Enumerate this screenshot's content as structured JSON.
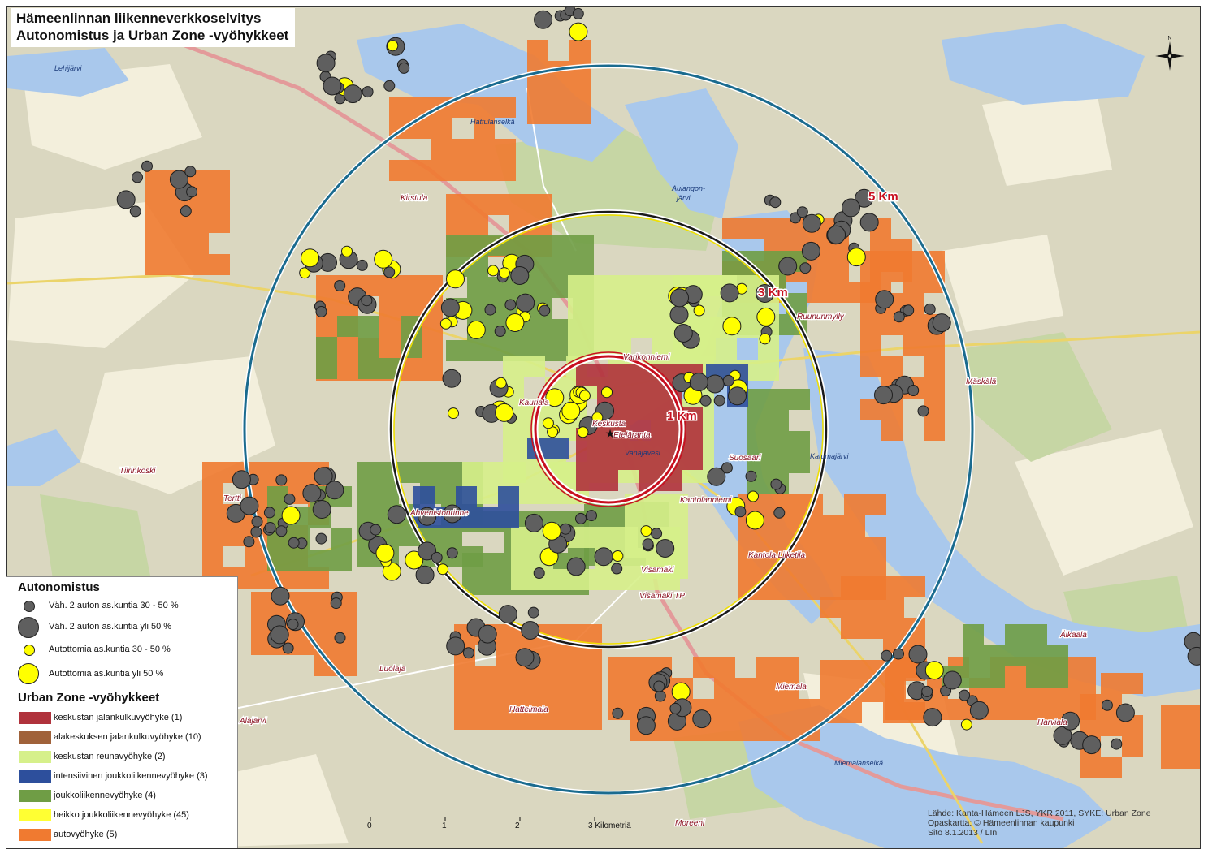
{
  "title": {
    "line1": "Hämeenlinnan liikenneverkkoselvitys",
    "line2": "Autonomistus  ja Urban Zone -vyöhykkeet"
  },
  "rings": [
    {
      "label": "1 Km",
      "color": "#c80f1f"
    },
    {
      "label": "3 Km",
      "color": "#1a1a1a"
    },
    {
      "label": "5 Km",
      "color": "#1a6b8f"
    }
  ],
  "places": [
    "Kirstula",
    "Ruununmylly",
    "Varikonniemi",
    "Kauriala",
    "Keskusta",
    "Eteläranta",
    "Suosaari",
    "Kantolanniemi",
    "Ahvenistonrinne",
    "Tertti",
    "Tiirinkoski",
    "Kantola Liiketila",
    "Visamäki",
    "Visamäki TP",
    "Luolaja",
    "Hattelmala",
    "Miemala",
    "Harviala",
    "Mäskälä",
    "Äikäälä",
    "Alajärvi",
    "Moreeni"
  ],
  "water_labels": [
    "Lehijärvi",
    "Hattulanselkä",
    "Aulangon-\njärvi",
    "Vanajavesi",
    "Katumajärvi",
    "Miemalanselkä"
  ],
  "legend": {
    "section1_title": "Autonomistus",
    "symbols": [
      {
        "label": "Väh. 2 auton as.kuntia 30 - 50 %",
        "color": "#5f5f5f",
        "size": "small"
      },
      {
        "label": "Väh. 2 auton as.kuntia yli 50 %",
        "color": "#5f5f5f",
        "size": "large"
      },
      {
        "label": "Autottomia as.kuntia 30 - 50 %",
        "color": "#ffff00",
        "size": "small"
      },
      {
        "label": "Autottomia as.kuntia yli 50 %",
        "color": "#ffff00",
        "size": "large"
      }
    ],
    "section2_title": "Urban Zone -vyöhykkeet",
    "zones": [
      {
        "label": "keskustan jalankulkuvyöhyke (1)",
        "color": "#b0323c"
      },
      {
        "label": "alakeskuksen jalankulkuvyöhyke (10)",
        "color": "#a0623a"
      },
      {
        "label": "keskustan reunavyöhyke (2)",
        "color": "#d6f08a"
      },
      {
        "label": "intensiivinen joukkoliikennevyöhyke (3)",
        "color": "#2d4f9c"
      },
      {
        "label": "joukkoliikennevyöhyke (4)",
        "color": "#6f9d45"
      },
      {
        "label": "heikko joukkoliikennevyöhyke (45)",
        "color": "#ffff33"
      },
      {
        "label": "autovyöhyke (5)",
        "color": "#f07a30"
      }
    ]
  },
  "scale": {
    "labels": [
      "0",
      "1",
      "2",
      "3 Kilometriä"
    ]
  },
  "credits": {
    "line1": "Lähde: Kanta-Hämeen LJS, YKR 2011, SYKE: Urban Zone",
    "line2": "Opaskartta: © Hämeenlinnan kaupunki",
    "line3": "Sito 8.1.2013 / LIn"
  },
  "colors": {
    "water": "#a9c8ec",
    "land": "#dad7c0",
    "field": "#f3efdc",
    "forest": "#c6d6a4",
    "car_owner": "#5f5f5f",
    "carless": "#ffff00"
  }
}
